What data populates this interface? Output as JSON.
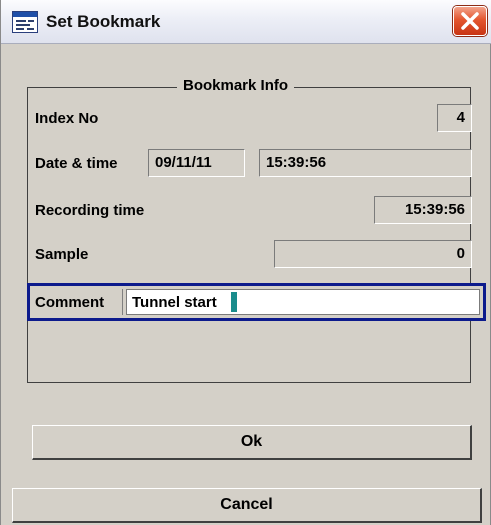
{
  "window": {
    "title": "Set Bookmark"
  },
  "group": {
    "legend": "Bookmark Info"
  },
  "fields": {
    "index_label": "Index No",
    "index_value": "4",
    "datetime_label": "Date & time",
    "date_value": "09/11/11",
    "time_value": "15:39:56",
    "recording_label": "Recording time",
    "recording_value": "15:39:56",
    "sample_label": "Sample",
    "sample_value": "0",
    "comment_label": "Comment",
    "comment_value": "Tunnel start"
  },
  "buttons": {
    "ok_label": "Ok",
    "cancel_label": "Cancel"
  },
  "icons": {
    "app": "bookmark-window-icon",
    "close": "close-icon"
  },
  "colors": {
    "dialog_bg": "#d4d0c8",
    "focus_border": "#0c1a8c",
    "close_red": "#e4562f"
  }
}
